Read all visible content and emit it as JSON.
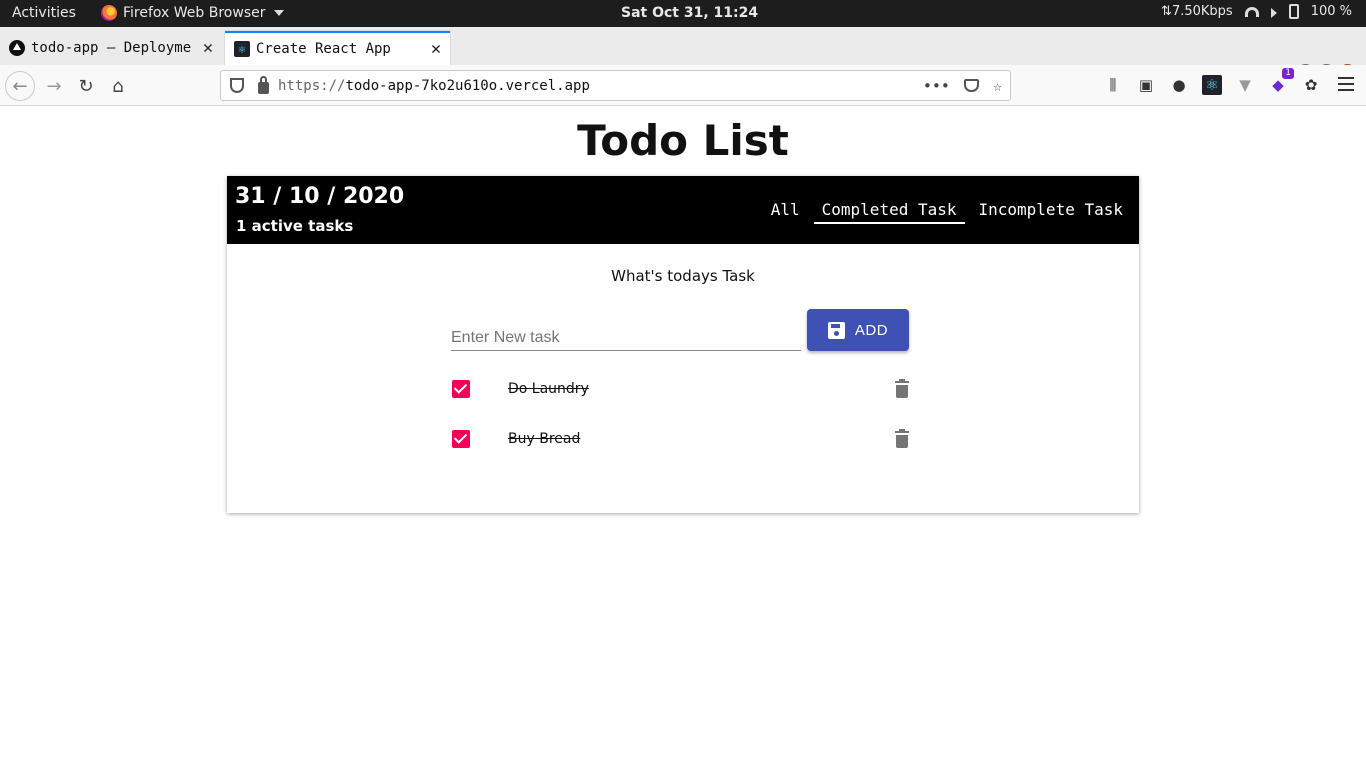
{
  "system_bar": {
    "activities": "Activities",
    "app_name": "Firefox Web Browser",
    "clock": "Sat Oct 31, 11:24",
    "network_speed": "⇅7.50Kbps",
    "battery": "100 %"
  },
  "browser": {
    "tabs": [
      {
        "title": "todo-app – Deployme",
        "favicon": "vercel-icon",
        "active": false
      },
      {
        "title": "Create React App",
        "favicon": "react-icon",
        "active": true
      }
    ],
    "url_scheme": "https://",
    "url_host": "todo-app-7ko2u610o.vercel.app",
    "extension_badge": "1"
  },
  "app": {
    "title": "Todo List",
    "header": {
      "date": "31 / 10 / 2020",
      "active_count": "1 active tasks",
      "filters": [
        "All",
        "Completed Task",
        "Incomplete Task"
      ],
      "selected_filter": "Completed Task"
    },
    "prompt": "What's todays Task",
    "input_placeholder": "Enter New task",
    "add_label": "ADD",
    "tasks": [
      {
        "text": "Do Laundry",
        "completed": true
      },
      {
        "text": "Buy Bread",
        "completed": true
      }
    ],
    "colors": {
      "accent": "#3f51b5",
      "checkbox": "#f50057",
      "header_bg": "#000000"
    }
  }
}
